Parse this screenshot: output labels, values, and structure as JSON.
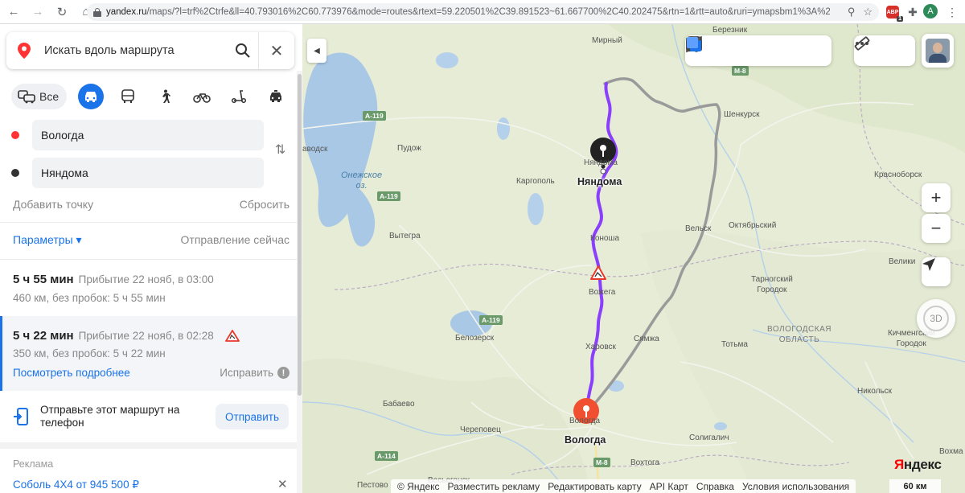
{
  "browser": {
    "url_host": "yandex.ru",
    "url_rest": "/maps/?l=trf%2Ctrfe&ll=40.793016%2C60.773976&mode=routes&rtext=59.220501%2C39.891523~61.667700%2C40.202475&rtn=1&rtt=auto&ruri=ymapsbm1%3A%2F%2Fg...",
    "abp_count": "1",
    "avatar_letter": "A"
  },
  "search": {
    "placeholder": "Искать вдоль маршрута"
  },
  "modes": {
    "all_label": "Все"
  },
  "waypoints": {
    "from": "Вологда",
    "to": "Няндома"
  },
  "links": {
    "add_point": "Добавить точку",
    "reset": "Сбросить",
    "params": "Параметры ▾",
    "departure": "Отправление сейчас"
  },
  "routes": [
    {
      "time": "5 ч 55 мин",
      "arrival": "Прибытие 22 нояб, в 03:00",
      "info": "460 км, без пробок: 5 ч 55 мин"
    },
    {
      "time": "5 ч 22 мин",
      "arrival": "Прибытие 22 нояб, в 02:28",
      "info": "350 км, без пробок: 5 ч 22 мин",
      "details": "Посмотреть подробнее",
      "fix": "Исправить"
    }
  ],
  "send": {
    "text": "Отправьте этот маршрут на телефон",
    "button": "Отправить"
  },
  "ad": {
    "label": "Реклама",
    "text": "Соболь 4Х4 от 945 500 ₽"
  },
  "map": {
    "pin_start": "Вологда",
    "pin_end": "Няндома",
    "lake": "Онежское\nоз.",
    "region": "ВОЛОГОДСКАЯ\nОБЛАСТЬ",
    "places": {
      "mirny": "Мирный",
      "berezn": "Березник",
      "shenkursk": "Шенкурск",
      "krasnoborsk": "Красноборск",
      "podvodsk": "аводск",
      "pudozh": "Пудож",
      "kargopol": "Каргополь",
      "nyandoma_small": "Няндома",
      "velsk": "Вельск",
      "oktyabrsky": "Октябрьский",
      "konosha": "Коноша",
      "vytegra": "Вытегра",
      "velikiy": "Велики",
      "tarnogsky": "Тарногский\nГородок",
      "vozhega": "Вожега",
      "belozersk": "Белозерск",
      "syamzha": "Сямжа",
      "totma": "Тотьма",
      "kichmengsky": "Кичменгский\nГородок",
      "kharovsk": "Харовск",
      "babaevo": "Бабаево",
      "vologda_small": "Вологда",
      "nikolsk": "Никольск",
      "cherepovets": "Череповец",
      "soligalich": "Солигалич",
      "vokhma": "Вохма",
      "vokhtoga": "Вохтога",
      "vesyegonsk": "Весьегонск",
      "pestovo": "Пестово"
    },
    "roads": {
      "m8_top": "М-8",
      "a119_top": "А-119",
      "a119_mid": "А-119",
      "a119_low": "А-119",
      "a114": "А-114",
      "m8_bot": "М-8"
    },
    "brand_y": "Я",
    "brand_rest": "ндекс",
    "footer": [
      "© Яндекс",
      "Разместить рекламу",
      "Редактировать карту",
      "API Карт",
      "Справка",
      "Условия использования"
    ],
    "scale": "60 км",
    "compass": "3D",
    "route_active_color": "#8a3ffc",
    "route_alt_color": "#9a9a9a"
  }
}
